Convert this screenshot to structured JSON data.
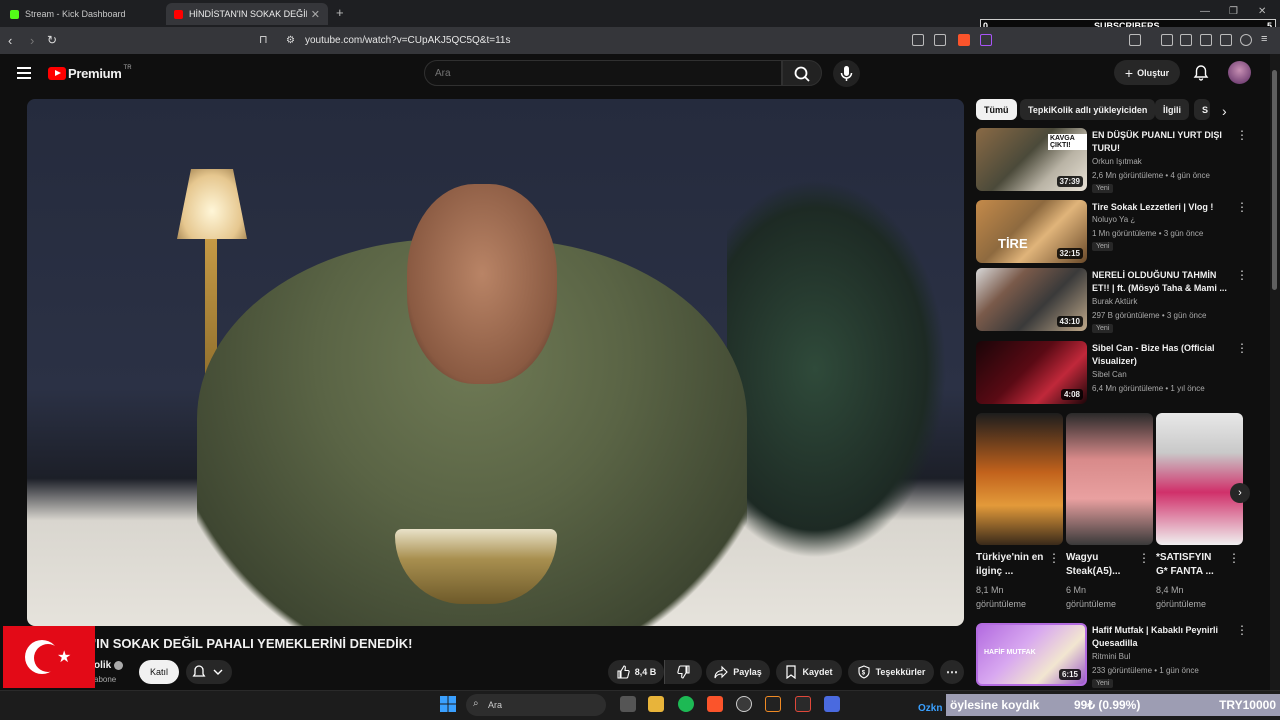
{
  "browser": {
    "tabs": [
      {
        "label": "Stream - Kick Dashboard"
      },
      {
        "label": "HİNDİSTAN'IN SOKAK DEĞİL"
      }
    ],
    "new_tab": "+",
    "url": "youtube.com/watch?v=CUpAKJ5QC5Q&t=11s"
  },
  "overlay": {
    "subscribers_label": "SUBSCRIBERS",
    "sub_left": "0",
    "sub_right": "5"
  },
  "youtube": {
    "logo_text": "Premium",
    "logo_region": "TR",
    "search_placeholder": "Ara",
    "create_label": "Oluştur",
    "video_title": "'IN SOKAK DEĞİL PAHALI YEMEKLERİNİ DENEDİK!",
    "channel_name": "olik",
    "channel_subs": "abone",
    "join_label": "Katıl",
    "like_count": "8,4 B",
    "share_label": "Paylaş",
    "save_label": "Kaydet",
    "thanks_label": "Teşekkürler"
  },
  "chips": [
    "Tümü",
    "TepkiKolik adlı yükleyiciden",
    "İlgili",
    "S"
  ],
  "recommendations": [
    {
      "title": "EN DÜŞÜK PUANLI YURT DIŞI TURU!",
      "channel": "Orkun Işıtmak",
      "meta": "2,6 Mn görüntüleme • 4 gün önce",
      "badge": "Yeni",
      "duration": "37:39",
      "thumb_text": "KAVGA ÇIKTI!"
    },
    {
      "title": "Tire Sokak Lezzetleri | Vlog !",
      "channel": "Noluyo Ya ¿",
      "meta": "1 Mn görüntüleme • 3 gün önce",
      "badge": "Yeni",
      "duration": "32:15",
      "thumb_text": "TİRE"
    },
    {
      "title": "NERELİ OLDUĞUNU TAHMİN ET!! | ft. (Mösyö Taha & Mami ...",
      "channel": "Burak Aktürk",
      "meta": "297 B görüntüleme • 3 gün önce",
      "badge": "Yeni",
      "duration": "43:10",
      "thumb_text": ""
    },
    {
      "title": "Sibel Can - Bize Has (Official Visualizer)",
      "channel": "Sibel Can",
      "meta": "6,4 Mn görüntüleme • 1 yıl önce",
      "badge": "",
      "duration": "4:08",
      "thumb_text": ""
    },
    {
      "title": "Hafif Mutfak | Kabaklı Peynirli Quesadilla",
      "channel": "Ritmini Bul",
      "meta": "233 görüntüleme • 1 gün önce",
      "badge": "Yeni",
      "duration": "6:15",
      "thumb_text": "HAFİF MUTFAK"
    }
  ],
  "shorts": [
    {
      "title": "Türkiye'nin en ilginç ...",
      "views": "8,1 Mn",
      "views_label": "görüntüleme"
    },
    {
      "title": "Wagyu Steak(A5)...",
      "views": "6 Mn",
      "views_label": "görüntüleme"
    },
    {
      "title": "*SATISFYIN G* FANTA ...",
      "views": "8,4 Mn",
      "views_label": "görüntüleme"
    }
  ],
  "taskbar": {
    "search_label": "Ara",
    "channel_text": "Ozkn"
  },
  "ticker": {
    "text": "öylesine koydık",
    "pct": "99₺ (0.99%)",
    "goal": "TRY10000"
  }
}
